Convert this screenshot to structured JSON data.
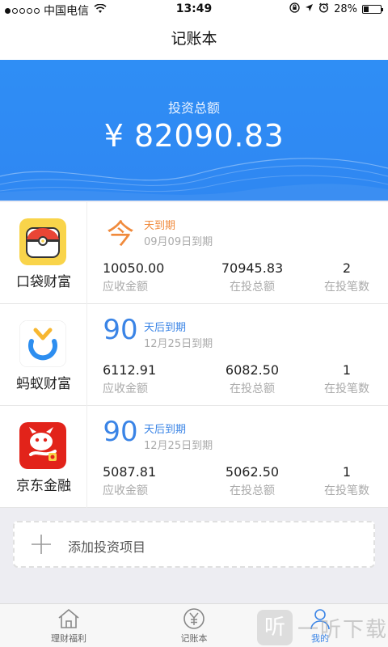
{
  "status_bar": {
    "carrier": "中国电信",
    "time": "13:49",
    "battery_percent": "28%",
    "battery_level": 0.28,
    "icons": [
      "signal-icon",
      "wifi-icon",
      "lock-rotation-icon",
      "location-icon",
      "alarm-icon",
      "battery-icon"
    ]
  },
  "nav": {
    "title": "记账本"
  },
  "hero": {
    "label": "投资总额",
    "amount": "¥ 82090.83",
    "background_color": "#2f8ef5"
  },
  "cards": [
    {
      "name": "口袋财富",
      "logo_icon": "pocket-wallet-icon",
      "days": "今",
      "days_label": "天到期",
      "due": "09月09日到期",
      "stats": [
        {
          "value": "10050.00",
          "label": "应收金额"
        },
        {
          "value": "70945.83",
          "label": "在投总额"
        },
        {
          "value": "2",
          "label": "在投笔数"
        }
      ]
    },
    {
      "name": "蚂蚁财富",
      "logo_icon": "ant-fortune-icon",
      "days": "90",
      "days_label": "天后到期",
      "due": "12月25日到期",
      "stats": [
        {
          "value": "6112.91",
          "label": "应收金额"
        },
        {
          "value": "6082.50",
          "label": "在投总额"
        },
        {
          "value": "1",
          "label": "在投笔数"
        }
      ]
    },
    {
      "name": "京东金融",
      "logo_icon": "jd-finance-icon",
      "days": "90",
      "days_label": "天后到期",
      "due": "12月25日到期",
      "stats": [
        {
          "value": "5087.81",
          "label": "应收金额"
        },
        {
          "value": "5062.50",
          "label": "在投总额"
        },
        {
          "value": "1",
          "label": "在投笔数"
        }
      ]
    }
  ],
  "add_project": {
    "label": "添加投资项目",
    "icon": "plus-icon"
  },
  "tabbar": {
    "tabs": [
      {
        "label": "理财福利",
        "icon": "house-icon"
      },
      {
        "label": "记账本",
        "icon": "yen-circle-icon"
      },
      {
        "label": "我的",
        "icon": "person-icon",
        "active": true
      }
    ],
    "accent_color": "#3a84e6"
  },
  "watermark": {
    "text": "一听下载",
    "icon_glyph": "听"
  }
}
